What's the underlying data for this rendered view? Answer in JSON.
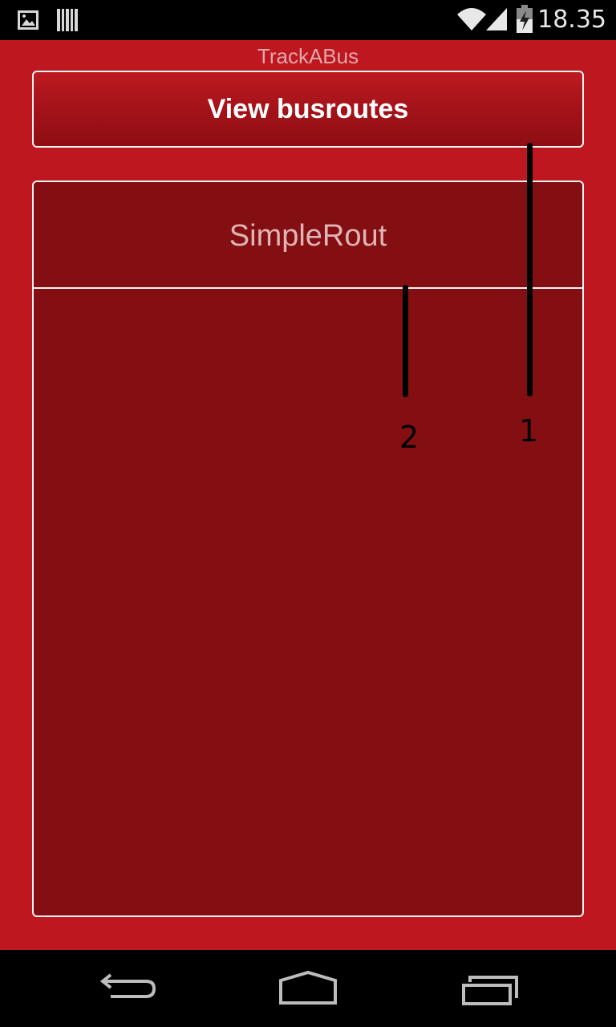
{
  "status_bar": {
    "time": "18.35",
    "icons": [
      "image-icon",
      "barcode-icon",
      "wifi-icon",
      "signal-icon",
      "battery-charging-icon"
    ]
  },
  "app": {
    "title": "TrackABus",
    "view_routes_label": "View busroutes",
    "route_name": "SimpleRout"
  },
  "annotations": [
    {
      "label": "1"
    },
    {
      "label": "2"
    }
  ],
  "nav_bar": {
    "icons": [
      "back-icon",
      "home-icon",
      "recent-apps-icon"
    ]
  },
  "colors": {
    "app_background": "#be1720",
    "panel_background": "#840f12",
    "border": "#f4f4f4"
  }
}
